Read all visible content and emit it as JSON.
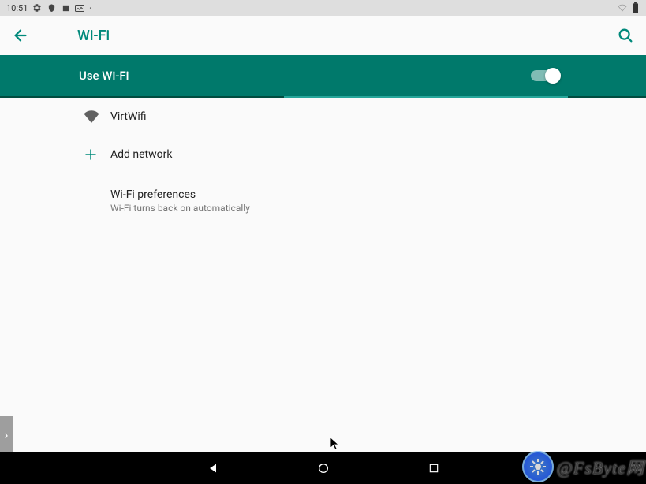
{
  "status": {
    "time": "10:51"
  },
  "appbar": {
    "title": "Wi-Fi"
  },
  "toggle": {
    "label": "Use Wi-Fi",
    "on": true
  },
  "networks": [
    {
      "name": "VirtWifi"
    }
  ],
  "add_network_label": "Add network",
  "wifi_prefs": {
    "title": "Wi-Fi preferences",
    "subtitle": "Wi-Fi turns back on automatically"
  },
  "watermark": "@FsByte网"
}
